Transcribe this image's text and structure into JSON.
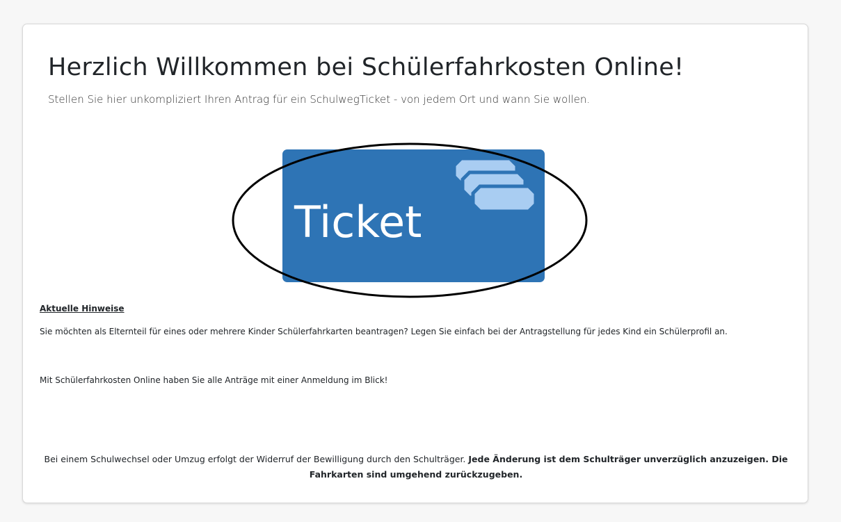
{
  "header": {
    "title": "Herzlich Willkommen bei Schülerfahrkosten Online!",
    "subtitle": "Stellen Sie hier unkompliziert Ihren Antrag für ein SchulwegTicket - von jedem Ort und wann Sie wollen."
  },
  "banner": {
    "ticket_text": "Ticket",
    "background_color": "#2e74b5",
    "ticket_icon_color": "#a9cdf2",
    "icon": "tickets-stack-icon"
  },
  "notes": {
    "heading": "Aktuelle Hinweise",
    "paragraph1": "Sie möchten als Elternteil für eines oder mehrere Kinder Schülerfahrkarten beantragen? Legen Sie einfach bei der Antragstellung für jedes Kind ein Schülerprofil an.",
    "paragraph2": "Mit Schülerfahrkosten Online haben Sie alle Anträge mit einer Anmeldung im Blick!"
  },
  "footer": {
    "text_regular": "Bei einem Schulwechsel oder Umzug erfolgt der Widerruf der Bewilligung durch den Schulträger.",
    "text_bold": "Jede Änderung ist dem Schulträger unverzüglich anzuzeigen. Die Fahrkarten sind umgehend zurückzugeben."
  }
}
